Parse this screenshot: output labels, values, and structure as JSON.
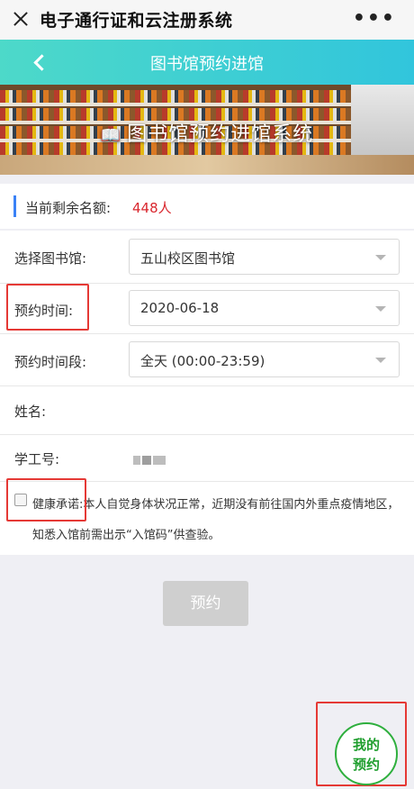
{
  "app": {
    "title": "电子通行证和云注册系统",
    "more": "•••"
  },
  "header": {
    "title": "图书馆预约进馆"
  },
  "banner": {
    "title": "图书馆预约进馆系统",
    "icon": "book-icon"
  },
  "quota": {
    "label": "当前剩余名额:",
    "value": "448人"
  },
  "form": {
    "library": {
      "label": "选择图书馆:",
      "value": "五山校区图书馆"
    },
    "date": {
      "label": "预约时间:",
      "value": "2020-06-18"
    },
    "period": {
      "label": "预约时间段:",
      "value": "全天 (00:00-23:59)"
    },
    "name": {
      "label": "姓名:",
      "value": ""
    },
    "student_id": {
      "label": "学工号:"
    }
  },
  "promise": {
    "text": "健康承诺:本人自觉身体状况正常，近期没有前往国内外重点疫情地区，知悉入馆前需出示“入馆码”供查验。"
  },
  "submit": {
    "label": "预约"
  },
  "my_reservation": {
    "line1": "我的",
    "line2": "预约"
  },
  "colors": {
    "accent": "#31c5dc",
    "quota_value": "#d9272e",
    "highlight": "#e53935",
    "my_button": "#2eaf3d"
  }
}
